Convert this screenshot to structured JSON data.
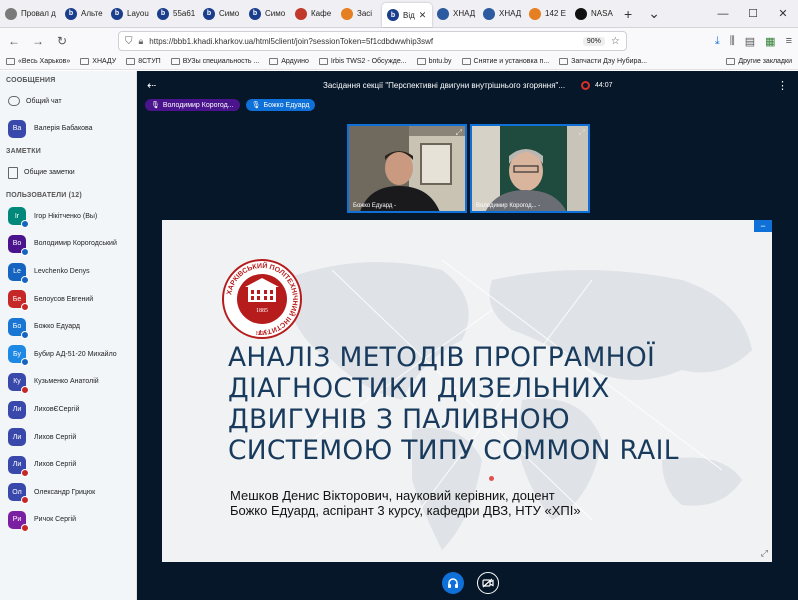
{
  "browser": {
    "tabs": [
      {
        "label": "Провал д",
        "fav_color": "#7a7a7a",
        "fav_char": ""
      },
      {
        "label": "Альте",
        "fav_color": "#1a3e8c",
        "fav_char": "b"
      },
      {
        "label": "Layou",
        "fav_color": "#1a3e8c",
        "fav_char": "b"
      },
      {
        "label": "55a61",
        "fav_color": "#1a3e8c",
        "fav_char": "b"
      },
      {
        "label": "Симо",
        "fav_color": "#1a3e8c",
        "fav_char": "b"
      },
      {
        "label": "Симо",
        "fav_color": "#1a3e8c",
        "fav_char": "b"
      },
      {
        "label": "Кафе",
        "fav_color": "#c0392b",
        "fav_char": ""
      },
      {
        "label": "Засі",
        "fav_color": "#e67e22",
        "fav_char": ""
      },
      {
        "label": "Від",
        "fav_color": "#1a3e8c",
        "fav_char": "b",
        "active": true
      },
      {
        "label": "ХНАД",
        "fav_color": "#2c5aa0",
        "fav_char": ""
      },
      {
        "label": "ХНАД",
        "fav_color": "#2c5aa0",
        "fav_char": ""
      },
      {
        "label": "142 Е",
        "fav_color": "#e67e22",
        "fav_char": ""
      },
      {
        "label": "NASA",
        "fav_color": "#111111",
        "fav_char": ""
      }
    ],
    "url": "https://bbb1.khadi.kharkov.ua/html5client/join?sessionToken=5f1cdbdwwhip3swf",
    "zoom": "90%",
    "bookmarks": [
      "«Весь Харьков»",
      "ХНАДУ",
      "8СТУП",
      "ВУЗы специальность ...",
      "Ардуино",
      "Irbis TWS2 - Обсужде...",
      "bntu.by",
      "Снятие и установка п...",
      "Запчасти Дэу Нубира..."
    ],
    "other_bookmarks": "Другие закладки"
  },
  "sidebar": {
    "messages_title": "СООБЩЕНИЯ",
    "public_chat": "Общий чат",
    "notes_title": "ЗАМЕТКИ",
    "shared_notes": "Общие заметки",
    "users_title": "ПОЛЬЗОВАТЕЛИ (12)",
    "top_user": {
      "initials": "Ва",
      "name": "Валерія Бабакова",
      "color": "#3949ab"
    },
    "users": [
      {
        "initials": "Ir",
        "name": "Ігор Нікітченко (Вы)",
        "color": "#00897b",
        "mic": "#1565c0"
      },
      {
        "initials": "Во",
        "name": "Володимир Корогодський",
        "color": "#4a148c",
        "mic": "#1565c0"
      },
      {
        "initials": "Le",
        "name": "Levchenko Denys",
        "color": "#1565c0",
        "mic": "#1565c0"
      },
      {
        "initials": "Бе",
        "name": "Белоусов Евгений",
        "color": "#c62828",
        "mic": "#c62828"
      },
      {
        "initials": "Бо",
        "name": "Божко Едуард",
        "color": "#1976d2",
        "mic": "#1565c0"
      },
      {
        "initials": "Бу",
        "name": "Бубир АД-51-20 Михайло",
        "color": "#1e88e5",
        "mic": "#1565c0"
      },
      {
        "initials": "Ку",
        "name": "Кузьменко Анатолій",
        "color": "#3949ab",
        "mic": "#c62828"
      },
      {
        "initials": "Ли",
        "name": "ЛиховЄСергій",
        "color": "#3949ab",
        "mic": ""
      },
      {
        "initials": "Ли",
        "name": "Лихов Сергій",
        "color": "#3949ab",
        "mic": ""
      },
      {
        "initials": "Ли",
        "name": "Лихов Сергій",
        "color": "#3949ab",
        "mic": "#c62828"
      },
      {
        "initials": "Ол",
        "name": "Олександр Грицюк",
        "color": "#3949ab",
        "mic": "#c62828"
      },
      {
        "initials": "Ри",
        "name": "Ричок Сергій",
        "color": "#7b1fa2",
        "mic": "#c62828"
      }
    ]
  },
  "meeting": {
    "title": "Засідання секції \"Перспективні двигуни внутрішнього згоряння\"...",
    "timer": "44:07",
    "talkers": [
      "Володимир Корогод...",
      "Божко Едуард"
    ],
    "video_labels": [
      "Божко Едуард -",
      "Володимир Корогод... -"
    ]
  },
  "slide": {
    "seal_ring_text": "ХАРКІВСЬКИЙ ПОЛІТЕХНІЧНИЙ ІНСТИТУТ",
    "seal_bottom": "НТУ",
    "seal_year": "1885",
    "title_lines": [
      "АНАЛІЗ МЕТОДІВ ПРОГРАМНОЇ",
      "ДІАГНОСТИКИ ДИЗЕЛЬНИХ",
      "ДВИГУНІВ З ПАЛИВНОЮ",
      "СИСТЕМОЮ ТИПУ COMMON RAIL"
    ],
    "author_line1": "Мешков Денис Вікторович, науковий керівник, доцент",
    "author_line2": "Божко Едуард, аспірант 3 курсу, кафедри ДВЗ, НТУ «ХПІ»"
  },
  "colors": {
    "accent": "#0f70d7",
    "bg_main": "#06172a",
    "slide_title": "#183a5c",
    "seal": "#b71c1c"
  }
}
